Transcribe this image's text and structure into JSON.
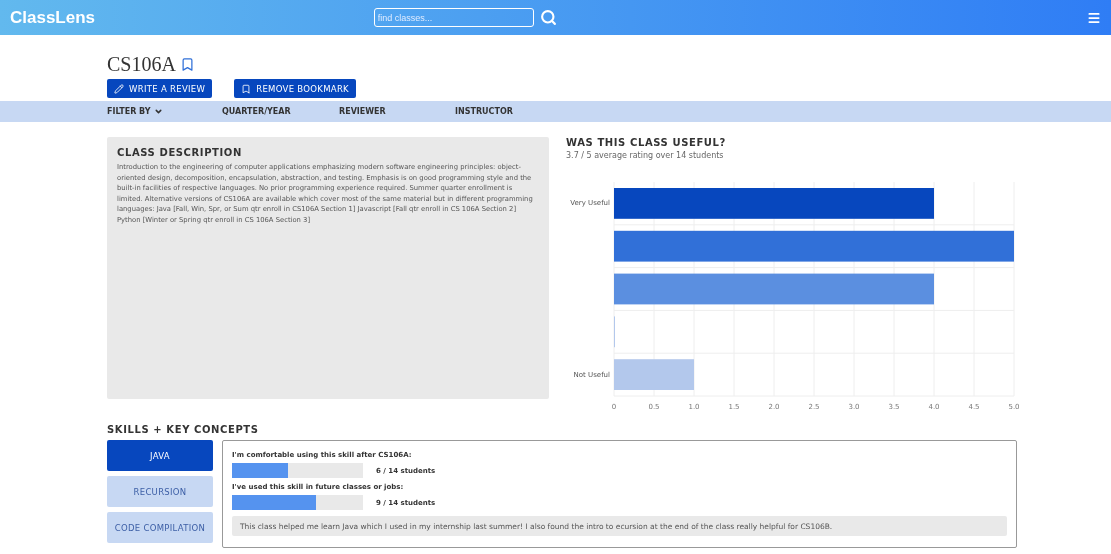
{
  "header": {
    "logo": "ClassLens",
    "search": {
      "placeholder": "find classes..."
    }
  },
  "course": {
    "title": "CS106A",
    "bookmarked": true,
    "actions": [
      "WRITE A REVIEW",
      "REMOVE BOOKMARK"
    ]
  },
  "filter_bar": {
    "label": "FILTER BY",
    "options": [
      "QUARTER/YEAR",
      "REVIEWER",
      "INSTRUCTOR"
    ]
  },
  "description": {
    "heading": "CLASS DESCRIPTION",
    "text": "Introduction to the engineering of computer applications emphasizing modern software engineering principles: object-oriented design, decomposition, encapsulation, abstraction, and testing. Emphasis is on good programming style and the built-in facilities of respective languages. No prior programming experience required. Summer quarter enrollment is limited. Alternative versions of CS106A are available which cover most of the same material but in different programming languages: Java [Fall, Win, Spr, or Sum qtr enroll in CS106A Section 1] Javascript [Fall qtr enroll in CS 106A Section 2] Python [Winter or Spring qtr enroll in CS 106A Section 3]"
  },
  "usefulness": {
    "heading": "WAS THIS CLASS USEFUL?",
    "summary": "3.7 / 5 average rating over 14 students",
    "chart_data": {
      "type": "bar",
      "orientation": "horizontal",
      "categories": [
        "Very Useful",
        null,
        null,
        null,
        "Not Useful"
      ],
      "series": [
        {
          "values": [
            4,
            5,
            4,
            0,
            1
          ]
        }
      ],
      "colors": [
        "#0747be",
        "#3170d8",
        "#5b8fe0",
        "#b3c8ec",
        "#b3c8ec"
      ],
      "xlim": [
        0,
        5
      ],
      "grid": true,
      "xticks": [
        0,
        0.5,
        {
          "value": 1,
          "label": "1.0"
        },
        1.5,
        {
          "value": 2,
          "label": "2.0"
        },
        2.5,
        {
          "value": 3,
          "label": "3.0"
        },
        3.5,
        {
          "value": 4,
          "label": "4.0"
        },
        4.5,
        {
          "value": 5,
          "label": "5.0"
        }
      ]
    }
  },
  "skills": {
    "heading": "SKILLS + KEY CONCEPTS",
    "items": [
      {
        "label": "JAVA",
        "selected": true
      },
      {
        "label": "RECURSION",
        "selected": false
      },
      {
        "label": "CODE COMPILATION",
        "selected": false
      }
    ],
    "stats": [
      {
        "question": "I'm comfortable using this skill after CS106A:",
        "level": 0.43,
        "reading": "6 / 14 students"
      },
      {
        "question": "I've used this skill in future classes or jobs:",
        "level": 0.64,
        "reading": "9 / 14 students"
      }
    ],
    "comment": "This class helped me learn Java which I used in my internship last summer! I also found the intro to ecursion at the end of the class really helpful for CS106B."
  }
}
